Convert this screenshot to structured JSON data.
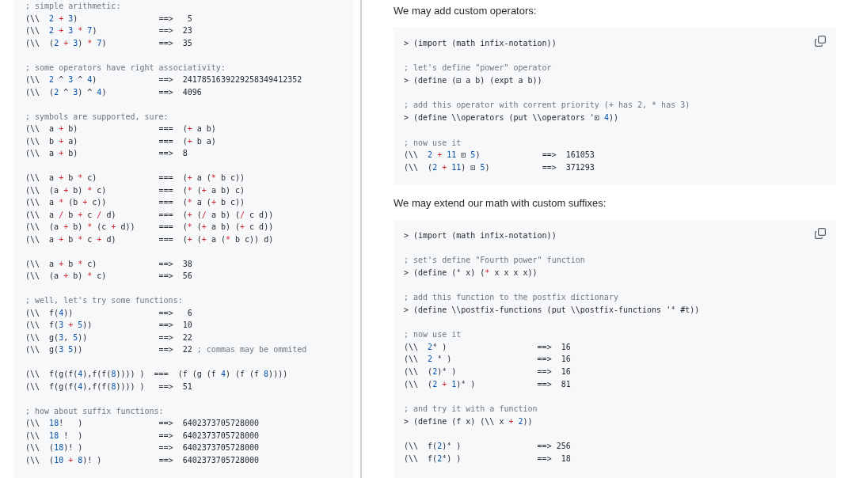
{
  "left_panel": {
    "code_block": {
      "groups": [
        [
          "; simple arithmetic:",
          "(\\\\  2 + 3)                 ==>   5",
          "(\\\\  2 + 3 * 7)             ==>  23",
          "(\\\\  (2 + 3) * 7)           ==>  35"
        ],
        [
          "; some operators have right associativity:",
          "(\\\\  2 ^ 3 ^ 4)             ==>  2417851639229258349412352",
          "(\\\\  (2 ^ 3) ^ 4)           ==>  4096"
        ],
        [
          "; symbols are supported, sure:",
          "(\\\\  a + b)                 ===  (+ a b)",
          "(\\\\  b + a)                 ===  (+ b a)",
          "(\\\\  a + b)                 ==>  8"
        ],
        [
          "(\\\\  a + b * c)             ===  (+ a (* b c))",
          "(\\\\  (a + b) * c)           ===  (* (+ a b) c)",
          "(\\\\  a * (b + c))           ===  (* a (+ b c))",
          "(\\\\  a / b + c / d)         ===  (+ (/ a b) (/ c d))",
          "(\\\\  (a + b) * (c + d))     ===  (* (+ a b) (+ c d))",
          "(\\\\  a + b * c + d)         ===  (+ (+ a (* b c)) d)"
        ],
        [
          "(\\\\  a + b * c)             ==>  38",
          "(\\\\  (a + b) * c)           ==>  56"
        ],
        [
          "; well, let's try some functions:",
          "(\\\\  f(4))                  ==>   6",
          "(\\\\  f(3 + 5))              ==>  10",
          "(\\\\  g(3, 5))               ==>  22",
          "(\\\\  g(3 5))                ==>  22 ; commas may be ommited"
        ],
        [
          "(\\\\  f(g(f(4),f(f(8)))) )  ===  (f (g (f 4) (f (f 8))))",
          "(\\\\  f(g(f(4),f(f(8)))) )   ==>  51"
        ],
        [
          "; how about suffix functions:",
          "(\\\\  18!   )                ==>  6402373705728000",
          "(\\\\  18 !  )                ==>  6402373705728000",
          "(\\\\  (18)! )                ==>  6402373705728000",
          "(\\\\  (10 + 8)! )            ==>  6402373705728000"
        ]
      ]
    }
  },
  "right_panel": {
    "sections": [
      {
        "intro": "We may add custom operators:",
        "code_block": {
          "groups": [
            [
              "> (import (math infix-notation))"
            ],
            [
              "; let's define \"power\" operator",
              "> (define (⊡ a b) (expt a b))"
            ],
            [
              "; add this operator with corrent priority (+ has 2, * has 3)",
              "> (define \\\\operators (put \\\\operators '⊡ 4))"
            ],
            [
              "; now use it",
              "(\\\\  2 + 11 ⊡ 5)             ==>  161053",
              "(\\\\  (2 + 11) ⊡ 5)           ==>  371293"
            ]
          ]
        }
      },
      {
        "intro": "We may extend our math with custom suffixes:",
        "code_block": {
          "groups": [
            [
              "> (import (math infix-notation))"
            ],
            [
              "; set's define \"Fourth power\" function",
              "> (define (⁴ x) (* x x x x))"
            ],
            [
              "; add this function to the postfix dictionary",
              "> (define \\\\postfix-functions (put \\\\postfix-functions '⁴ #t))"
            ],
            [
              "; now use it",
              "(\\\\  2⁴ )                   ==>  16",
              "(\\\\  2 ⁴ )                  ==>  16",
              "(\\\\  (2)⁴ )                 ==>  16",
              "(\\\\  (2 + 1)⁴ )             ==>  81"
            ],
            [
              "; and try it with a function",
              "> (define (f x) (\\\\ x + 2))"
            ],
            [
              "(\\\\  f(2)⁴ )                ==> 256",
              "(\\\\  f(2⁴) )                ==>  18"
            ]
          ]
        }
      }
    ]
  }
}
